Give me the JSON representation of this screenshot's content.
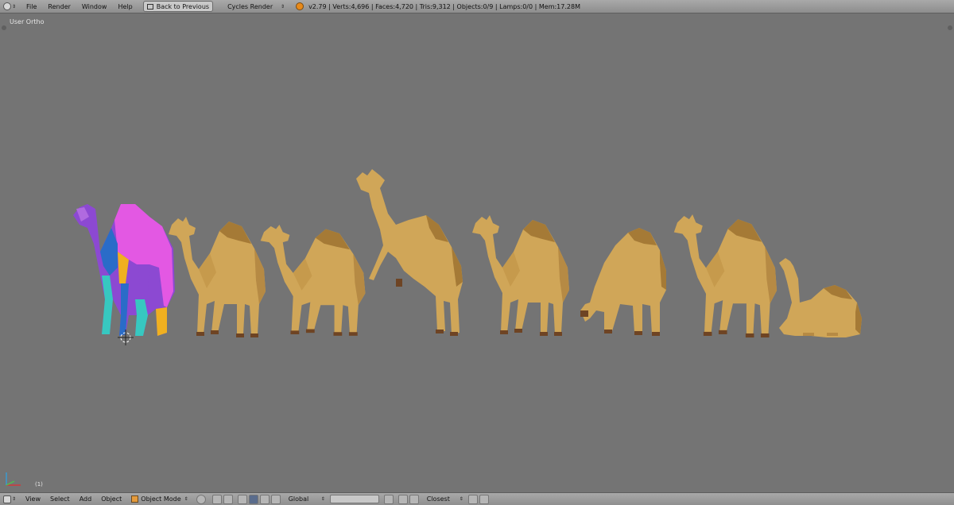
{
  "topbar": {
    "menu": [
      "File",
      "Render",
      "Window",
      "Help"
    ],
    "back_label": "Back to Previous",
    "engine": "Cycles Render",
    "stats": "v2.79 | Verts:4,696 | Faces:4,720 | Tris:9,312 | Objects:0/9 | Lamps:0/0 | Mem:17.28M"
  },
  "viewport": {
    "view_label": "User Ortho",
    "frame_label": "(1)"
  },
  "bottombar": {
    "menu": [
      "View",
      "Select",
      "Add",
      "Object"
    ],
    "mode": "Object Mode",
    "orientation": "Global",
    "snap": "Closest"
  },
  "colors": {
    "camel": "#d0a658",
    "camel_shade": "#a57a36",
    "camel_hoof": "#6e4424",
    "uv_magenta": "#e358e3",
    "uv_purple": "#8c49d2",
    "uv_blue": "#2a6cc8",
    "uv_teal": "#37c8c0",
    "uv_yellow": "#f0b020"
  }
}
